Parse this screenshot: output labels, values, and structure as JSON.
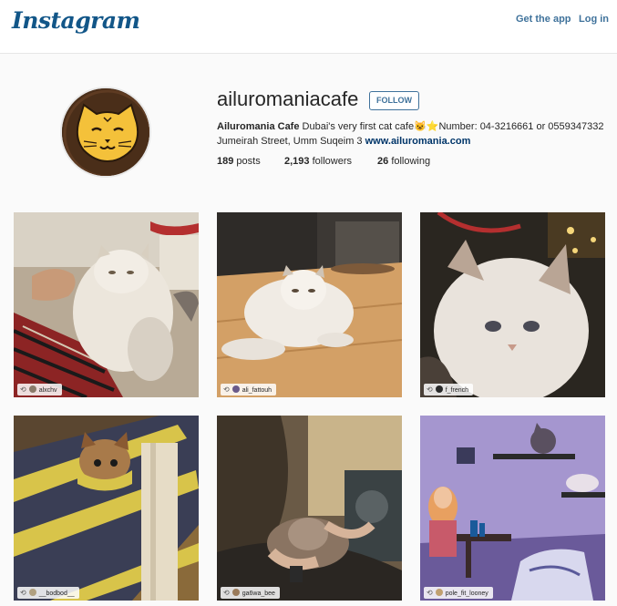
{
  "header": {
    "logo_text": "Instagram",
    "get_app_label": "Get the app",
    "login_label": "Log in"
  },
  "profile": {
    "username": "ailuromaniacafe",
    "follow_label": "FOLLOW",
    "full_name": "Ailuromania Cafe",
    "bio_text": "Dubai's very first cat cafe😺⭐Number: 04-3216661 or 0559347332 Jumeirah Street, Umm Suqeim 3",
    "website": "www.ailuromania.com",
    "stats": {
      "posts_count": "189",
      "posts_label": "posts",
      "followers_count": "2,193",
      "followers_label": "followers",
      "following_count": "26",
      "following_label": "following"
    }
  },
  "posts": [
    {
      "credit": "alxchv"
    },
    {
      "credit": "ali_fattouh"
    },
    {
      "credit": "f_french"
    },
    {
      "credit": "__bodbod__"
    },
    {
      "credit": "ga6wa_bee"
    },
    {
      "credit": "pole_fit_looney"
    }
  ],
  "colors": {
    "brand_blue": "#3f729b",
    "logo_blue": "#125688",
    "link_blue": "#003569"
  }
}
